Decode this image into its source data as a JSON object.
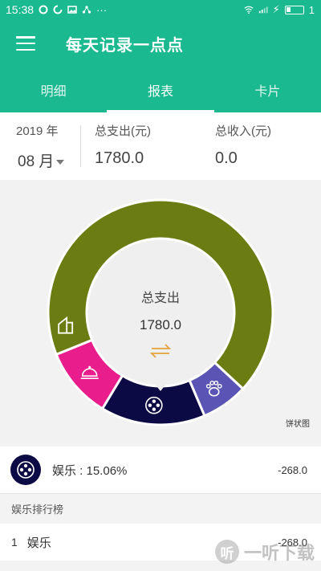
{
  "status_bar": {
    "time": "15:38",
    "battery_level": "1"
  },
  "app": {
    "title": "每天记录一点点"
  },
  "tabs": [
    {
      "label": "明细",
      "active": false
    },
    {
      "label": "报表",
      "active": true
    },
    {
      "label": "卡片",
      "active": false
    }
  ],
  "summary": {
    "year": "2019 年",
    "month": "08 月",
    "expense_label": "总支出(元)",
    "expense_value": "1780.0",
    "income_label": "总收入(元)",
    "income_value": "0.0"
  },
  "chart_data": {
    "type": "pie",
    "style": "donut",
    "center_label": "总支出",
    "center_value": "1780.0",
    "chart_type_label": "饼状图",
    "slices": [
      {
        "name": "居住",
        "percent": 68.0,
        "color": "#6b7d12",
        "icon": "house-icon"
      },
      {
        "name": "宠物",
        "percent": 6.7,
        "color": "#5a55b5",
        "icon": "paw-icon"
      },
      {
        "name": "娱乐",
        "percent": 15.06,
        "color": "#0c0a45",
        "icon": "film-reel-icon"
      },
      {
        "name": "餐饮",
        "percent": 10.24,
        "color": "#e91e8c",
        "icon": "food-cloche-icon"
      }
    ],
    "colors": {
      "accent": "#1ab98f",
      "switch_icon": "#e6a23c"
    }
  },
  "top_category": {
    "label": "娱乐 : 15.06%",
    "amount": "-268.0",
    "icon": "film-reel-icon"
  },
  "ranking": {
    "title": "娱乐排行榜",
    "items": [
      {
        "rank": "1",
        "name": "娱乐",
        "amount": "-268.0"
      }
    ]
  },
  "watermark": {
    "text": "一听下载",
    "glyph": "听"
  }
}
